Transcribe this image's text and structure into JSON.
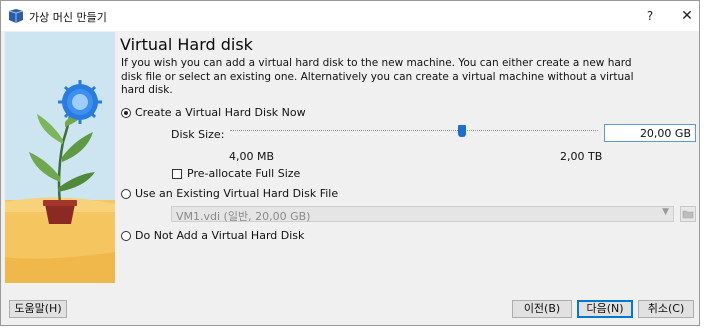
{
  "window": {
    "title": "가상 머신 만들기",
    "help_label": "?",
    "close_label": "✕"
  },
  "page": {
    "title": "Virtual Hard disk",
    "description": "If you wish you can add a virtual hard disk to the new machine. You can either create a new hard disk file or select an existing one. Alternatively you can create a virtual machine without a virtual hard disk."
  },
  "options": {
    "create_now": {
      "label": "Create a Virtual Hard Disk Now",
      "checked": true
    },
    "disk_size_label": "Disk Size:",
    "disk_size_value": "20,00 GB",
    "slider_fraction": 0.63,
    "slider_min_label": "4,00 MB",
    "slider_max_label": "2,00 TB",
    "preallocate": {
      "label": "Pre-allocate Full Size",
      "checked": false
    },
    "use_existing": {
      "label": "Use an Existing Virtual Hard Disk File",
      "checked": false
    },
    "existing_file_value": "VM1.vdi (일반, 20,00 GB)",
    "no_disk": {
      "label": "Do Not Add a Virtual Hard Disk",
      "checked": false
    }
  },
  "buttons": {
    "help": "도움말(H)",
    "back": "이전(B)",
    "next": "다음(N)",
    "cancel": "취소(C)"
  },
  "colors": {
    "accent": "#0078d7",
    "slider_thumb": "#1a6fd1",
    "art_background": "#cfe6f3"
  }
}
